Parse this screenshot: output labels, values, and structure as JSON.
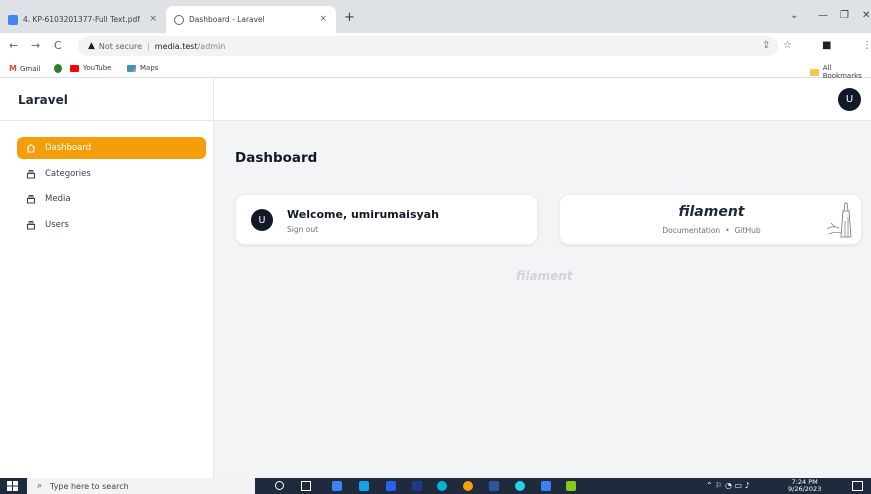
{
  "browser": {
    "tabs": [
      {
        "title": "4. KP-6103201377-Full Text.pdf",
        "active": false
      },
      {
        "title": "Dashboard - Laravel",
        "active": true
      }
    ],
    "close_glyph": "×",
    "new_tab_glyph": "+",
    "address": {
      "security": "Not secure",
      "host": "media.test",
      "path": "/admin"
    },
    "bookmarks": [
      "Gmail",
      "YouTube",
      "Maps"
    ],
    "all_bookmarks": "All Bookmarks"
  },
  "app": {
    "brand": "Laravel",
    "user_initial": "U",
    "nav": [
      {
        "label": "Dashboard",
        "active": true,
        "icon": "home-icon"
      },
      {
        "label": "Categories",
        "active": false,
        "icon": "collection-icon"
      },
      {
        "label": "Media",
        "active": false,
        "icon": "collection-icon"
      },
      {
        "label": "Users",
        "active": false,
        "icon": "collection-icon"
      }
    ],
    "page_title": "Dashboard",
    "welcome": {
      "text": "Welcome, umirumaisyah",
      "signout": "Sign out"
    },
    "filament": {
      "logo": "filament",
      "documentation": "Documentation",
      "separator": "•",
      "github": "GitHub"
    },
    "footer_logo": "filament",
    "accent_color": "#f59e0b"
  },
  "taskbar": {
    "search_placeholder": "Type here to search",
    "time": "7:24 PM",
    "date": "9/26/2023"
  }
}
